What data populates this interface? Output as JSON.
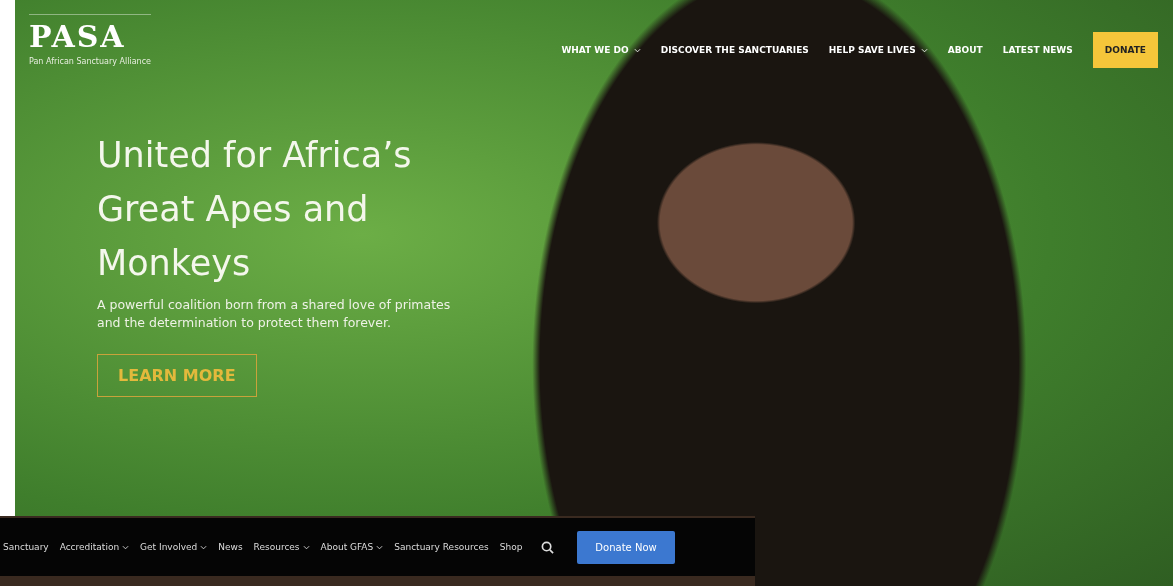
{
  "logo": {
    "wordmark": "PASA",
    "tagline": "Pan African Sanctuary Alliance"
  },
  "nav": [
    {
      "label": "WHAT WE DO",
      "dropdown": true
    },
    {
      "label": "DISCOVER THE SANCTUARIES",
      "dropdown": false
    },
    {
      "label": "HELP SAVE LIVES",
      "dropdown": true
    },
    {
      "label": "ABOUT",
      "dropdown": false
    },
    {
      "label": "LATEST NEWS",
      "dropdown": false
    }
  ],
  "donate_button": "DONATE",
  "hero": {
    "title": "United for Africa’s Great Apes and Monkeys",
    "text": "A powerful coalition born from a shared love of primates and the determination to protect them forever.",
    "button": "LEARN MORE"
  },
  "second_nav": {
    "items": [
      {
        "label": "Sanctuary",
        "dropdown": false
      },
      {
        "label": "Accreditation",
        "dropdown": true
      },
      {
        "label": "Get Involved",
        "dropdown": true
      },
      {
        "label": "News",
        "dropdown": false
      },
      {
        "label": "Resources",
        "dropdown": true
      },
      {
        "label": "About GFAS",
        "dropdown": true
      },
      {
        "label": "Sanctuary Resources",
        "dropdown": false
      },
      {
        "label": "Shop",
        "dropdown": false
      }
    ],
    "button": "Donate Now"
  }
}
